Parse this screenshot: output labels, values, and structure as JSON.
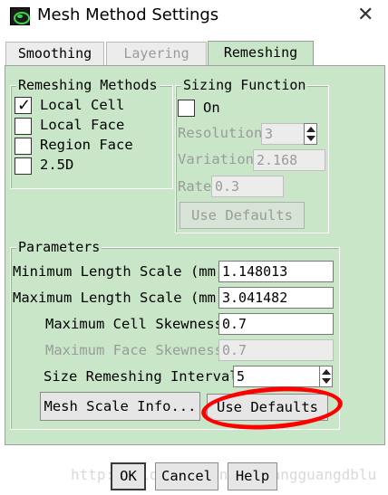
{
  "window": {
    "title": "Mesh Method Settings"
  },
  "tabs": [
    {
      "label": "Smoothing",
      "state": "normal"
    },
    {
      "label": "Layering",
      "state": "disabled"
    },
    {
      "label": "Remeshing",
      "state": "active"
    }
  ],
  "remeshing_methods": {
    "title": "Remeshing Methods",
    "options": [
      {
        "label": "Local Cell",
        "checked": true
      },
      {
        "label": "Local Face",
        "checked": false
      },
      {
        "label": "Region Face",
        "checked": false
      },
      {
        "label": "2.5D",
        "checked": false
      }
    ]
  },
  "sizing_function": {
    "title": "Sizing Function",
    "on_label": "On",
    "on_checked": false,
    "resolution_label": "Resolution",
    "resolution_value": "3",
    "variation_label": "Variation",
    "variation_value": "2.168",
    "rate_label": "Rate",
    "rate_value": "0.3",
    "use_defaults_label": "Use Defaults"
  },
  "parameters": {
    "title": "Parameters",
    "min_length_label": "Minimum Length Scale (mm)",
    "min_length_value": "1.148013",
    "max_length_label": "Maximum Length Scale (mm)",
    "max_length_value": "3.041482",
    "max_cell_skew_label": "Maximum Cell Skewness",
    "max_cell_skew_value": "0.7",
    "max_face_skew_label": "Maximum Face Skewness",
    "max_face_skew_value": "0.7",
    "interval_label": "Size Remeshing Interval",
    "interval_value": "5",
    "mesh_scale_info_label": "Mesh Scale Info...",
    "use_defaults_label": "Use Defaults"
  },
  "footer": {
    "ok_label": "OK",
    "cancel_label": "Cancel",
    "help_label": "Help"
  },
  "watermark": "http://blog.csdn.net/huangguangdblu",
  "colors": {
    "panel": "#c9e7c8",
    "annotation": "#ff0000"
  }
}
